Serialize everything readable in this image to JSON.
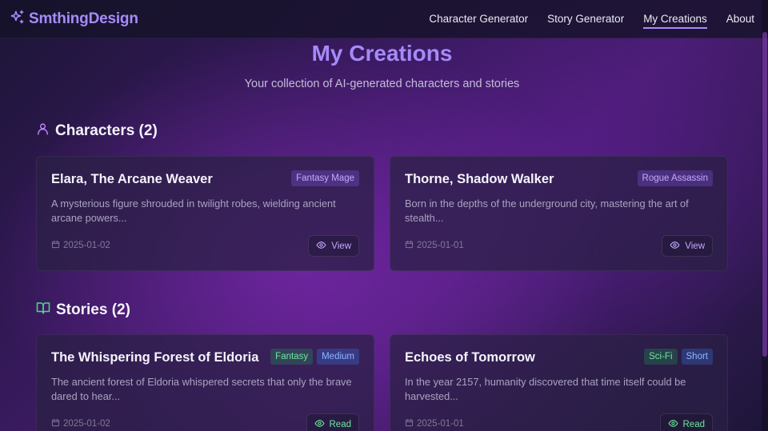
{
  "brand": {
    "name": "SmthingDesign",
    "icon": "sparkles-icon"
  },
  "nav": [
    {
      "label": "Character Generator",
      "active": false
    },
    {
      "label": "Story Generator",
      "active": false
    },
    {
      "label": "My Creations",
      "active": true
    },
    {
      "label": "About",
      "active": false
    }
  ],
  "header": {
    "title": "My Creations",
    "subtitle": "Your collection of AI-generated characters and stories"
  },
  "characters": {
    "title": "Characters (2)",
    "icon": "user-icon",
    "items": [
      {
        "name": "Elara, The Arcane Weaver",
        "tags": [
          "Fantasy Mage"
        ],
        "description": "A mysterious figure shrouded in twilight robes, wielding ancient arcane powers...",
        "date": "2025-01-02",
        "action": "View"
      },
      {
        "name": "Thorne, Shadow Walker",
        "tags": [
          "Rogue Assassin"
        ],
        "description": "Born in the depths of the underground city, mastering the art of stealth...",
        "date": "2025-01-01",
        "action": "View"
      }
    ]
  },
  "stories": {
    "title": "Stories (2)",
    "icon": "book-open-icon",
    "items": [
      {
        "name": "The Whispering Forest of Eldoria",
        "tags": [
          "Fantasy",
          "Medium"
        ],
        "description": "The ancient forest of Eldoria whispered secrets that only the brave dared to hear...",
        "date": "2025-01-02",
        "action": "Read"
      },
      {
        "name": "Echoes of Tomorrow",
        "tags": [
          "Sci-Fi",
          "Short"
        ],
        "description": "In the year 2157, humanity discovered that time itself could be harvested...",
        "date": "2025-01-01",
        "action": "Read"
      }
    ]
  },
  "colors": {
    "accent": "#a78bfa",
    "tag_purple": "#c4a9ff",
    "tag_green": "#6ee79a",
    "tag_blue": "#8fb6ff"
  }
}
